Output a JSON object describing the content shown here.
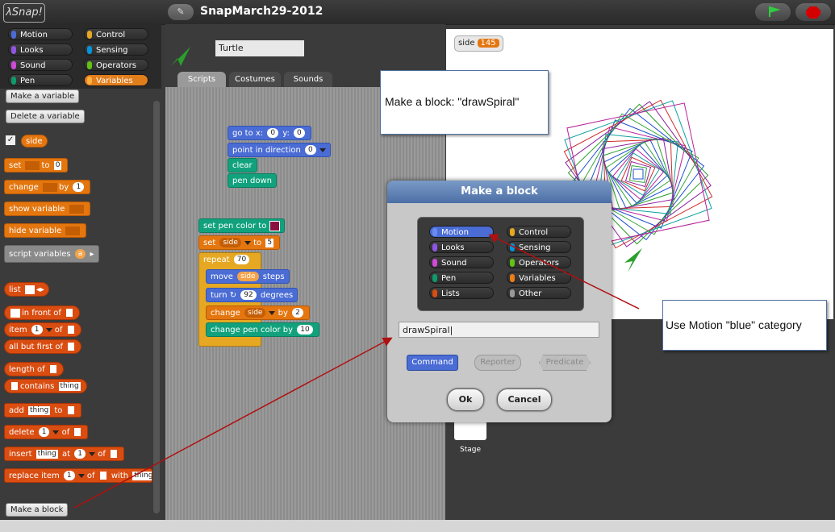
{
  "app": {
    "logo": "λSnap!",
    "project_name": "SnapMarch29-2012",
    "cloud_icon": "✎"
  },
  "categories": [
    "Motion",
    "Looks",
    "Sound",
    "Pen",
    "Control",
    "Sensing",
    "Operators",
    "Variables"
  ],
  "category_colors": {
    "Motion": "#4a6cd4",
    "Looks": "#8f56e3",
    "Sound": "#cf4ad9",
    "Pen": "#0e9a6c",
    "Control": "#e6a822",
    "Sensing": "#0494dc",
    "Operators": "#62c213",
    "Variables": "#ee7d16"
  },
  "palette": {
    "make_variable": "Make a variable",
    "delete_variable": "Delete a variable",
    "var_side": "side",
    "set_block": {
      "label": "set",
      "to": "to",
      "value": "0"
    },
    "change_block": {
      "label": "change",
      "by": "by",
      "value": "1"
    },
    "show_variable": "show variable",
    "hide_variable": "hide variable",
    "script_variables": {
      "label": "script variables",
      "slot": "a"
    },
    "list": "list",
    "in_front_of": "in front of",
    "item": {
      "label": "item",
      "value": "1",
      "of": "of"
    },
    "all_but_first": "all but first of",
    "length_of": "length of",
    "contains": {
      "label": "contains",
      "value": "thing"
    },
    "add": {
      "label": "add",
      "value": "thing",
      "to": "to"
    },
    "delete": {
      "label": "delete",
      "value": "1",
      "of": "of"
    },
    "insert": {
      "label": "insert",
      "value": "thing",
      "at": "at",
      "index": "1",
      "of": "of"
    },
    "replace": {
      "label": "replace item",
      "index": "1",
      "of": "of",
      "with": "with",
      "value": "thing"
    },
    "make_block": "Make a block"
  },
  "sprite": {
    "name": "Turtle",
    "tabs": [
      "Scripts",
      "Costumes",
      "Sounds"
    ]
  },
  "script1": {
    "goto": {
      "label": "go to x:",
      "x": "0",
      "y_label": "y:",
      "y": "0"
    },
    "point": {
      "label": "point in direction",
      "value": "0"
    },
    "clear": "clear",
    "pen_down": "pen down"
  },
  "script2": {
    "set_pen_color": "set pen color to",
    "set_side": {
      "label": "set",
      "var": "side",
      "to": "to",
      "value": "5"
    },
    "repeat": {
      "label": "repeat",
      "value": "70"
    },
    "move": {
      "label": "move",
      "var": "side",
      "steps": "steps"
    },
    "turn": {
      "label": "turn ↻",
      "value": "92",
      "degrees": "degrees"
    },
    "change_side": {
      "label": "change",
      "var": "side",
      "by": "by",
      "value": "2"
    },
    "change_pen": {
      "label": "change pen color by",
      "value": "10"
    }
  },
  "stage": {
    "watcher_label": "side",
    "watcher_value": "145",
    "stage_label": "Stage"
  },
  "callouts": {
    "make_block": "Make a block: \"drawSpiral\"",
    "use_motion": "Use Motion \"blue\" category"
  },
  "dialog": {
    "title": "Make a block",
    "categories": [
      "Motion",
      "Looks",
      "Sound",
      "Pen",
      "Lists",
      "Control",
      "Sensing",
      "Operators",
      "Variables",
      "Other"
    ],
    "selected_category": "Motion",
    "input_value": "drawSpiral",
    "shapes": [
      "Command",
      "Reporter",
      "Predicate"
    ],
    "ok": "Ok",
    "cancel": "Cancel"
  },
  "dialog_category_colors": {
    "Motion": "#4a6cd4",
    "Looks": "#8f56e3",
    "Sound": "#cf4ad9",
    "Pen": "#0e9a6c",
    "Lists": "#d94d11",
    "Control": "#e6a822",
    "Sensing": "#0494dc",
    "Operators": "#62c213",
    "Variables": "#ee7d16",
    "Other": "#999999"
  }
}
